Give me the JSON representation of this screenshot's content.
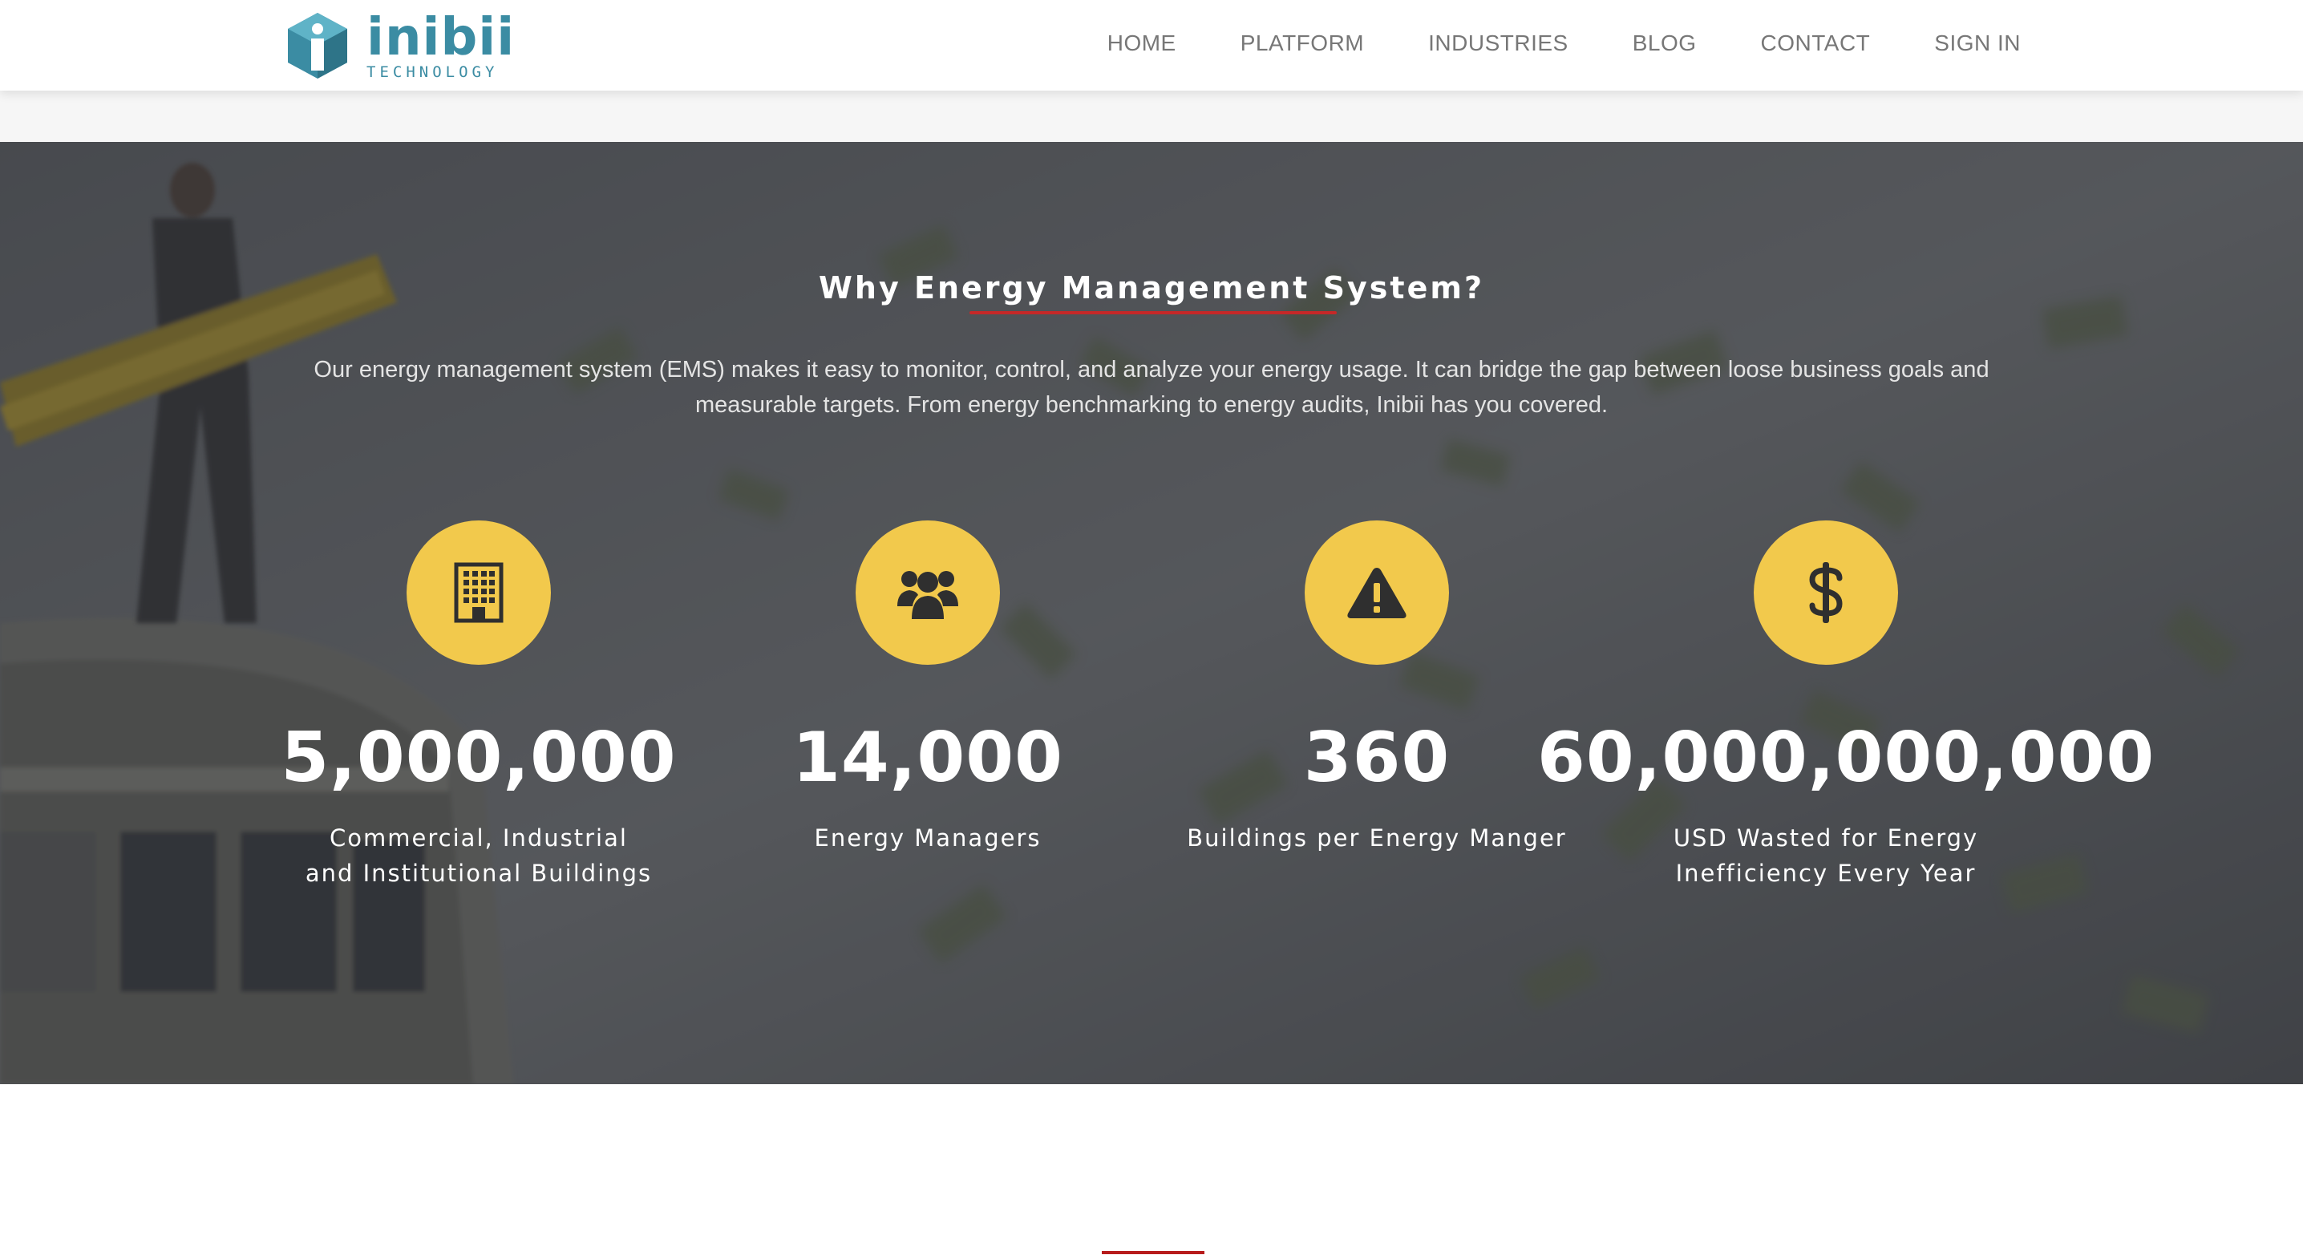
{
  "brand": {
    "name": "inibii",
    "tagline": "TECHNOLOGY",
    "color": "#3b8ca3"
  },
  "nav": {
    "items": [
      "HOME",
      "PLATFORM",
      "INDUSTRIES",
      "BLOG",
      "CONTACT",
      "SIGN IN"
    ]
  },
  "hero": {
    "title": "Why Energy Management System?",
    "description": "Our energy management system (EMS) makes it easy to monitor, control, and analyze your energy usage. It can bridge the gap between loose business goals and measurable targets. From energy benchmarking to energy audits, Inibii has you covered.",
    "accent_color": "#f2c94c",
    "underline_color": "#c62828"
  },
  "stats": [
    {
      "icon": "building-icon",
      "value": "5,000,000",
      "label": "Commercial, Industrial and Institutional Buildings"
    },
    {
      "icon": "users-icon",
      "value": "14,000",
      "label": "Energy Managers"
    },
    {
      "icon": "warning-icon",
      "value": "360",
      "label": "Buildings per Energy Manger"
    },
    {
      "icon": "dollar-icon",
      "value": "60,000,000,000",
      "label": "USD Wasted for Energy Inefficiency Every Year"
    }
  ]
}
